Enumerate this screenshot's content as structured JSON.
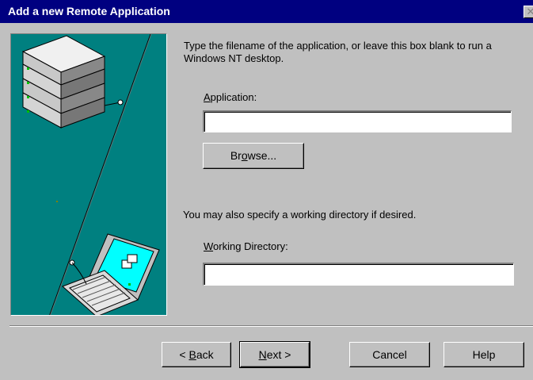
{
  "window": {
    "title": "Add a new Remote Application",
    "close_symbol": "✕"
  },
  "instruction": "Type the filename of the application, or leave this box blank to run a Windows NT desktop.",
  "application": {
    "label_accel": "A",
    "label_rest": "pplication:",
    "value": ""
  },
  "browse": {
    "pre": "Br",
    "accel": "o",
    "post": "wse..."
  },
  "working_dir_info": "You may also specify a working directory if desired.",
  "working_directory": {
    "label_accel": "W",
    "label_rest": "orking Directory:",
    "value": ""
  },
  "buttons": {
    "back": {
      "pre": "< ",
      "accel": "B",
      "post": "ack"
    },
    "next": {
      "pre": "",
      "accel": "N",
      "post": "ext >"
    },
    "cancel": "Cancel",
    "help": "Help"
  },
  "colors": {
    "titlebar": "#000080",
    "dialog": "#c0c0c0",
    "illustration_bg": "#008080"
  }
}
